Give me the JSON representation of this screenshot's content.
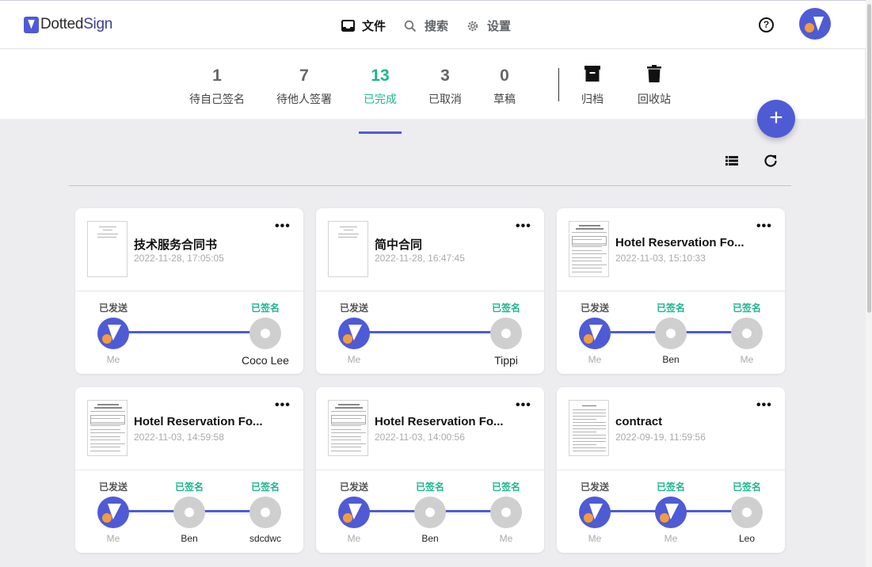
{
  "app": {
    "logo_dotted": "Dotted",
    "logo_sign": "Sign"
  },
  "nav": [
    {
      "label": "文件",
      "icon": "inbox-icon",
      "active": true
    },
    {
      "label": "搜索",
      "icon": "search-icon",
      "active": false
    },
    {
      "label": "设置",
      "icon": "gear-icon",
      "active": false
    }
  ],
  "header": {
    "help_label": "?"
  },
  "status_tabs": [
    {
      "count": "1",
      "label": "待自己签名",
      "active": false
    },
    {
      "count": "7",
      "label": "待他人签署",
      "active": false
    },
    {
      "count": "13",
      "label": "已完成",
      "active": true
    },
    {
      "count": "3",
      "label": "已取消",
      "active": false
    },
    {
      "count": "0",
      "label": "草稿",
      "active": false
    }
  ],
  "tools": [
    {
      "label": "归档",
      "icon": "archive-icon"
    },
    {
      "label": "回收站",
      "icon": "trash-icon"
    }
  ],
  "fab_label": "+",
  "step_labels": {
    "sent": "已发送",
    "signed": "已签名",
    "me": "Me"
  },
  "colors": {
    "accent": "#4f5bd5",
    "success": "#1db58f",
    "avatar_dot": "#f59b3c",
    "background": "#ededf0"
  },
  "cards": [
    {
      "title": "技术服务合同书",
      "date": "2022-11-28, 17:05:05",
      "thumb": "simple",
      "steps": [
        {
          "status": "sent",
          "name": "Me",
          "avatar": "blue"
        },
        {
          "status": "signed",
          "name": "Coco Lee",
          "avatar": "gray"
        }
      ]
    },
    {
      "title": "简中合同",
      "date": "2022-11-28, 16:47:45",
      "thumb": "simple",
      "steps": [
        {
          "status": "sent",
          "name": "Me",
          "avatar": "blue"
        },
        {
          "status": "signed",
          "name": "Tippi",
          "avatar": "gray"
        }
      ]
    },
    {
      "title": "Hotel Reservation Fo...",
      "date": "2022-11-03, 15:10:33",
      "thumb": "form",
      "steps": [
        {
          "status": "sent",
          "name": "Me",
          "avatar": "blue"
        },
        {
          "status": "signed",
          "name": "Ben",
          "avatar": "gray"
        },
        {
          "status": "signed",
          "name": "Me",
          "avatar": "gray"
        }
      ]
    },
    {
      "title": "Hotel Reservation Fo...",
      "date": "2022-11-03, 14:59:58",
      "thumb": "form",
      "steps": [
        {
          "status": "sent",
          "name": "Me",
          "avatar": "blue"
        },
        {
          "status": "signed",
          "name": "Ben",
          "avatar": "gray"
        },
        {
          "status": "signed",
          "name": "sdcdwc",
          "avatar": "gray"
        }
      ]
    },
    {
      "title": "Hotel Reservation Fo...",
      "date": "2022-11-03, 14:00:56",
      "thumb": "form",
      "steps": [
        {
          "status": "sent",
          "name": "Me",
          "avatar": "blue"
        },
        {
          "status": "signed",
          "name": "Ben",
          "avatar": "gray"
        },
        {
          "status": "signed",
          "name": "Me",
          "avatar": "gray"
        }
      ]
    },
    {
      "title": "contract",
      "date": "2022-09-19, 11:59:56",
      "thumb": "text",
      "steps": [
        {
          "status": "sent",
          "name": "Me",
          "avatar": "blue"
        },
        {
          "status": "signed",
          "name": "Me",
          "avatar": "blue"
        },
        {
          "status": "signed",
          "name": "Leo",
          "avatar": "gray"
        }
      ]
    }
  ]
}
